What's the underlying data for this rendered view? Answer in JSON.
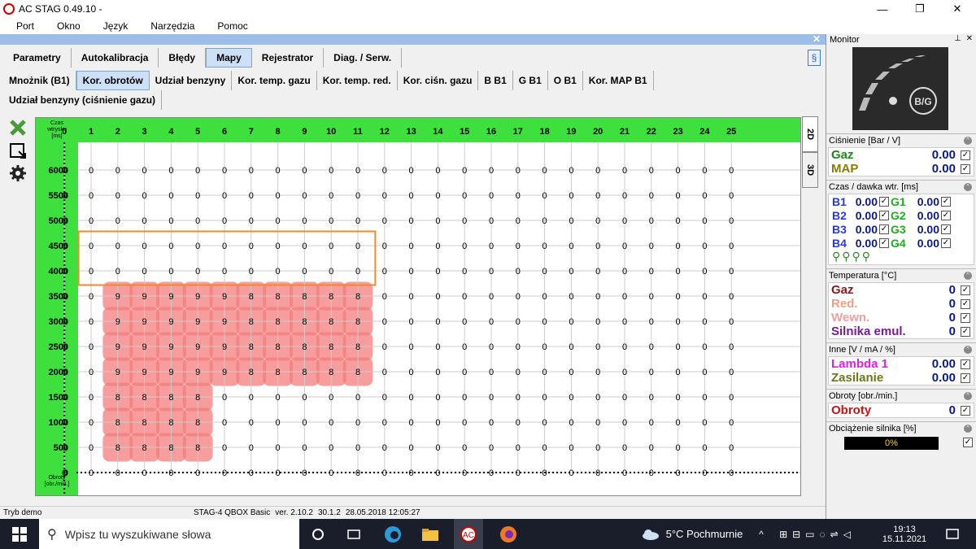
{
  "window": {
    "title": "AC STAG 0.49.10 -",
    "min": "—",
    "max": "❐",
    "close": "✕"
  },
  "menu": [
    "Port",
    "Okno",
    "Język",
    "Narzędzia",
    "Pomoc"
  ],
  "main_tabs": [
    {
      "label": "Parametry",
      "active": false
    },
    {
      "label": "Autokalibracja",
      "active": false
    },
    {
      "label": "Błędy",
      "active": false
    },
    {
      "label": "Mapy",
      "active": true
    },
    {
      "label": "Rejestrator",
      "active": false
    },
    {
      "label": "Diag. / Serw.",
      "active": false
    }
  ],
  "help_label": "§",
  "strip_close": "✕",
  "sub_tabs": [
    {
      "label": "Mnożnik (B1)",
      "active": false
    },
    {
      "label": "Kor. obrotów",
      "active": true
    },
    {
      "label": "Udział benzyny",
      "active": false
    },
    {
      "label": "Kor. temp. gazu",
      "active": false
    },
    {
      "label": "Kor. temp. red.",
      "active": false
    },
    {
      "label": "Kor. ciśn. gazu",
      "active": false
    },
    {
      "label": "B B1",
      "active": false
    },
    {
      "label": "G B1",
      "active": false
    },
    {
      "label": "O B1",
      "active": false
    },
    {
      "label": "Kor. MAP B1",
      "active": false
    },
    {
      "label": "Udział benzyny (ciśnienie gazu)",
      "active": false
    }
  ],
  "tools": [
    "accept-icon",
    "export-icon",
    "gear-icon"
  ],
  "grid": {
    "corner_label": "Czas wtrysku [ms]",
    "bottom_label": "Obroty [obr./min.]",
    "columns": [
      "0",
      "1",
      "2",
      "3",
      "4",
      "5",
      "6",
      "7",
      "8",
      "9",
      "10",
      "11",
      "12",
      "13",
      "14",
      "15",
      "16",
      "17",
      "18",
      "19",
      "20",
      "21",
      "22",
      "23",
      "24",
      "25"
    ],
    "rows": [
      {
        "label": "6000",
        "values": [
          0,
          0,
          0,
          0,
          0,
          0,
          0,
          0,
          0,
          0,
          0,
          0,
          0,
          0,
          0,
          0,
          0,
          0,
          0,
          0,
          0,
          0,
          0,
          0,
          0,
          0
        ]
      },
      {
        "label": "5500",
        "values": [
          0,
          0,
          0,
          0,
          0,
          0,
          0,
          0,
          0,
          0,
          0,
          0,
          0,
          0,
          0,
          0,
          0,
          0,
          0,
          0,
          0,
          0,
          0,
          0,
          0,
          0
        ]
      },
      {
        "label": "5000",
        "values": [
          0,
          0,
          0,
          0,
          0,
          0,
          0,
          0,
          0,
          0,
          0,
          0,
          0,
          0,
          0,
          0,
          0,
          0,
          0,
          0,
          0,
          0,
          0,
          0,
          0,
          0
        ]
      },
      {
        "label": "4500",
        "values": [
          0,
          0,
          0,
          0,
          0,
          0,
          0,
          0,
          0,
          0,
          0,
          0,
          0,
          0,
          0,
          0,
          0,
          0,
          0,
          0,
          0,
          0,
          0,
          0,
          0,
          0
        ]
      },
      {
        "label": "4000",
        "values": [
          0,
          0,
          0,
          0,
          0,
          0,
          0,
          0,
          0,
          0,
          0,
          0,
          0,
          0,
          0,
          0,
          0,
          0,
          0,
          0,
          0,
          0,
          0,
          0,
          0,
          0
        ]
      },
      {
        "label": "3500",
        "values": [
          0,
          0,
          9,
          9,
          9,
          9,
          9,
          8,
          8,
          8,
          8,
          8,
          0,
          0,
          0,
          0,
          0,
          0,
          0,
          0,
          0,
          0,
          0,
          0,
          0,
          0
        ]
      },
      {
        "label": "3000",
        "values": [
          0,
          0,
          9,
          9,
          9,
          9,
          9,
          8,
          8,
          8,
          8,
          8,
          0,
          0,
          0,
          0,
          0,
          0,
          0,
          0,
          0,
          0,
          0,
          0,
          0,
          0
        ]
      },
      {
        "label": "2500",
        "values": [
          0,
          0,
          9,
          9,
          9,
          9,
          9,
          8,
          8,
          8,
          8,
          8,
          0,
          0,
          0,
          0,
          0,
          0,
          0,
          0,
          0,
          0,
          0,
          0,
          0,
          0
        ]
      },
      {
        "label": "2000",
        "values": [
          0,
          0,
          9,
          9,
          9,
          9,
          9,
          8,
          8,
          8,
          8,
          8,
          0,
          0,
          0,
          0,
          0,
          0,
          0,
          0,
          0,
          0,
          0,
          0,
          0,
          0
        ]
      },
      {
        "label": "1500",
        "values": [
          0,
          0,
          8,
          8,
          8,
          8,
          0,
          0,
          0,
          0,
          0,
          0,
          0,
          0,
          0,
          0,
          0,
          0,
          0,
          0,
          0,
          0,
          0,
          0,
          0,
          0
        ]
      },
      {
        "label": "1000",
        "values": [
          0,
          0,
          8,
          8,
          8,
          8,
          0,
          0,
          0,
          0,
          0,
          0,
          0,
          0,
          0,
          0,
          0,
          0,
          0,
          0,
          0,
          0,
          0,
          0,
          0,
          0
        ]
      },
      {
        "label": "500",
        "values": [
          0,
          0,
          8,
          8,
          8,
          8,
          0,
          0,
          0,
          0,
          0,
          0,
          0,
          0,
          0,
          0,
          0,
          0,
          0,
          0,
          0,
          0,
          0,
          0,
          0,
          0
        ]
      },
      {
        "label": "0",
        "values": [
          0,
          0,
          0,
          0,
          0,
          0,
          0,
          0,
          0,
          0,
          0,
          0,
          0,
          0,
          0,
          0,
          0,
          0,
          0,
          0,
          0,
          0,
          0,
          0,
          0,
          0
        ]
      }
    ],
    "highlight_color": "#f47c7c",
    "selection_color": "#f08a2a",
    "header_color": "#3ee03e"
  },
  "view_tabs": [
    {
      "label": "2D",
      "active": true
    },
    {
      "label": "3D",
      "active": false
    }
  ],
  "status": {
    "mode": "Tryb demo",
    "device": "STAG-4 QBOX Basic",
    "ver_label": "ver. 2.10.2",
    "build": "30.1.2",
    "date": "28.05.2018 12:05:27"
  },
  "monitor": {
    "title": "Monitor",
    "pin": "⊥",
    "close": "✕",
    "gauge_label": "B/G",
    "pressure": {
      "title": "Ciśnienie [Bar / V]",
      "rows": [
        {
          "label": "Gaz",
          "value": "0.00",
          "color": "#1a8a1a"
        },
        {
          "label": "MAP",
          "value": "0.00",
          "color": "#8a7a00"
        }
      ]
    },
    "injection": {
      "title": "Czas / dawka wtr. [ms]",
      "rows": [
        {
          "b": "B1",
          "bv": "0.00",
          "g": "G1",
          "gv": "0.00"
        },
        {
          "b": "B2",
          "bv": "0.00",
          "g": "G2",
          "gv": "0.00"
        },
        {
          "b": "B3",
          "bv": "0.00",
          "g": "G3",
          "gv": "0.00"
        },
        {
          "b": "B4",
          "bv": "0.00",
          "g": "G4",
          "gv": "0.00"
        }
      ]
    },
    "temperature": {
      "title": "Temperatura [°C]",
      "rows": [
        {
          "label": "Gaz",
          "value": "0",
          "color": "#8a1a1a"
        },
        {
          "label": "Red.",
          "value": "0",
          "color": "#f0a080"
        },
        {
          "label": "Wewn.",
          "value": "0",
          "color": "#f0a0a0"
        },
        {
          "label": "Silnika emul.",
          "value": "0",
          "color": "#7a1a9a"
        }
      ]
    },
    "other": {
      "title": "Inne [V / mA / %]",
      "rows": [
        {
          "label": "Lambda 1",
          "value": "0.00",
          "color": "#e020e0"
        },
        {
          "label": "Zasilanie",
          "value": "0.00",
          "color": "#6a7a1a"
        }
      ]
    },
    "rpm": {
      "title": "Obroty [obr./min.]",
      "label": "Obroty",
      "value": "0",
      "color": "#d01010"
    },
    "load": {
      "title": "Obciążenie silnika [%]",
      "value": "0%"
    }
  },
  "taskbar": {
    "search_placeholder": "Wpisz tu wyszukiwane słowa",
    "weather": "5°C  Pochmurnie",
    "time": "19:13",
    "date": "15.11.2021"
  }
}
